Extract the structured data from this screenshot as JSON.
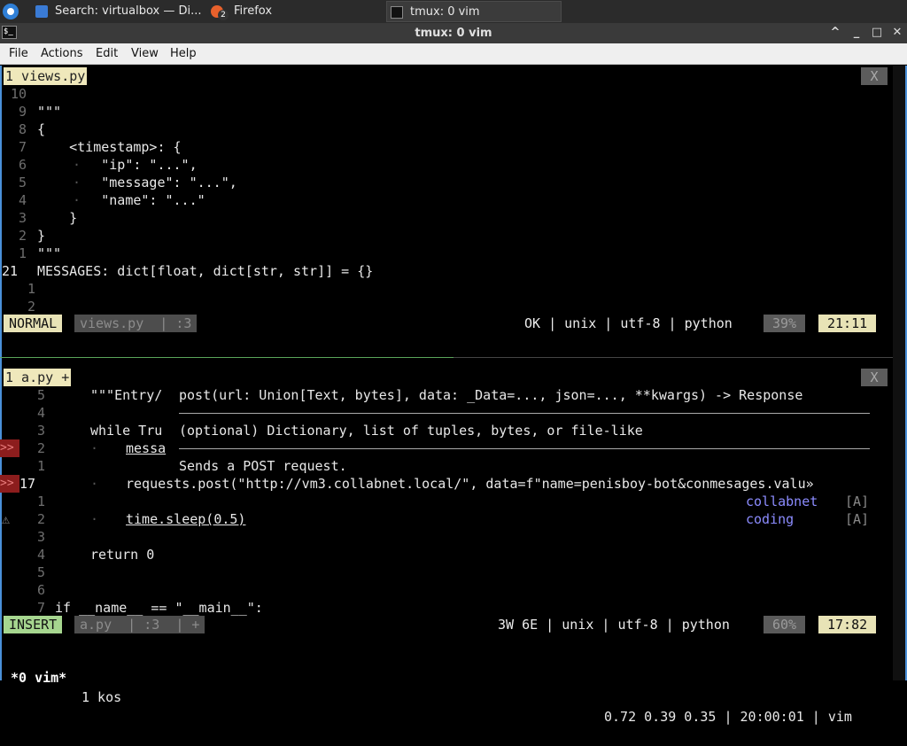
{
  "taskbar": {
    "tasks": [
      {
        "label": "Search: virtualbox — Di...",
        "icon": "window-icon"
      },
      {
        "label": "Firefox",
        "icon": "firefox-icon",
        "badge": "2"
      },
      {
        "label": "tmux: 0 vim",
        "icon": "terminal-icon"
      }
    ]
  },
  "window": {
    "title": "tmux: 0 vim",
    "controls": {
      "minimize": "^",
      "maximize": "_",
      "restore": "□",
      "close": "✕"
    }
  },
  "menubar": {
    "items": [
      "File",
      "Actions",
      "Edit",
      "View",
      "Help"
    ]
  },
  "top_pane": {
    "tab_label": "1 views.py",
    "close_label": "X",
    "lines": [
      {
        "ln": "10",
        "text": ""
      },
      {
        "ln": " 9",
        "text": "\"\"\""
      },
      {
        "ln": " 8",
        "text": "{"
      },
      {
        "ln": " 7",
        "text": "    <timestamp>: {"
      },
      {
        "ln": " 6",
        "text": "        \"ip\": \"...\","
      },
      {
        "ln": " 5",
        "text": "        \"message\": \"...\","
      },
      {
        "ln": " 4",
        "text": "        \"name\": \"...\""
      },
      {
        "ln": " 3",
        "text": "    }"
      },
      {
        "ln": " 2",
        "text": "}"
      },
      {
        "ln": " 1",
        "text": "\"\"\""
      },
      {
        "ln": "21",
        "text": "MESSAGES: dict[float, dict[str, str]] = {}"
      },
      {
        "ln": " 1",
        "text": ""
      },
      {
        "ln": " 2",
        "text": ""
      }
    ],
    "status": {
      "mode": "NORMAL",
      "file": "views.py  | :3",
      "right": "OK | unix | utf-8 | python",
      "percent": "39%",
      "position": "21:11"
    }
  },
  "bottom_pane": {
    "tab_label": "1 a.py +",
    "close_label": "X",
    "signature": "post(url: Union[Text, bytes], data: _Data=..., json=..., **kwargs) -> Response",
    "sig_doc1": "(optional) Dictionary, list of tuples, bytes, or file-like",
    "sig_doc2": "Sends a POST request.",
    "lines": [
      {
        "ln": "5",
        "text": "\"\"\"Entry/"
      },
      {
        "ln": "4",
        "text": ""
      },
      {
        "ln": "3",
        "text": "while Tru"
      },
      {
        "ln": "2",
        "text": "messa"
      },
      {
        "ln": "1",
        "text": ""
      },
      {
        "ln": "17",
        "text": "requests.post(\"http://vm3.collabnet.local/\", data=f\"name=penisboy-bot&conmesages.valu»"
      },
      {
        "ln": "1",
        "text": ""
      },
      {
        "ln": "2",
        "text": "time.sleep(0.5)"
      },
      {
        "ln": "3",
        "text": ""
      },
      {
        "ln": "4",
        "text": "return 0"
      },
      {
        "ln": "5",
        "text": ""
      },
      {
        "ln": "6",
        "text": ""
      },
      {
        "ln": "7",
        "text": "if __name__ == \"__main__\":"
      }
    ],
    "signs": {
      "error": ">>",
      "warning": "⚠"
    },
    "completion": [
      {
        "word": "collabnet",
        "kind": "[A]"
      },
      {
        "word": "coding",
        "kind": "[A]"
      }
    ],
    "status": {
      "mode": "INSERT",
      "file": "a.py  | :3  | +",
      "right": "3W 6E | unix | utf-8 | python",
      "percent": "60%",
      "position": "17:82"
    }
  },
  "tmux": {
    "window": "*0 vim*",
    "session": "1 kos",
    "right": "0.72 0.39 0.35 | 20:00:01 | vim"
  }
}
